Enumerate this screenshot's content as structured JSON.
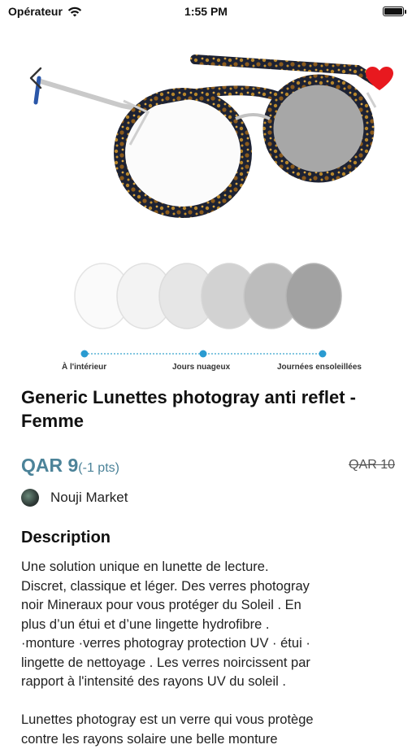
{
  "status_bar": {
    "carrier": "Opérateur",
    "time": "1:55 PM"
  },
  "hero": {
    "scale_labels": [
      "À l'intérieur",
      "Jours nuageux",
      "Journées ensoleillées"
    ]
  },
  "product": {
    "title": "Generic Lunettes photogray anti reflet - Femme",
    "price": "QAR 9",
    "points": "(-1 pts)",
    "old_price": "QAR 10",
    "seller": "Nouji Market"
  },
  "description": {
    "heading": "Description",
    "body": "Une solution unique en lunette de lecture.\nDiscret, classique et léger. Des verres photogray\nnoir Mineraux pour vous protéger du Soleil . En\nplus d’un étui et d’une lingette hydrofibre .\n·monture  ·verres photogray protection UV · étui ·\nlingette de nettoyage . Les verres noircissent par\nrapport à l'intensité des rayons UV du soleil .\n\nLunettes photogray est un verre qui vous protège\ncontre les rayons solaire une belle monture"
  },
  "colors": {
    "accent": "#4c8399",
    "favorite": "#e8191f"
  }
}
